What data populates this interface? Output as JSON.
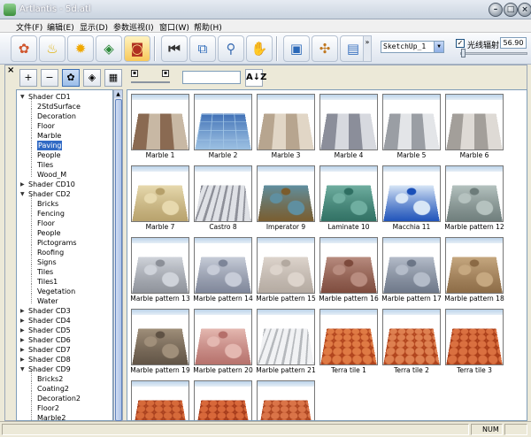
{
  "window": {
    "title": "Artlantis - 5d.atl"
  },
  "menu": [
    "文件(F)",
    "编辑(E)",
    "显示(D)",
    "参数巡视(I)",
    "窗口(W)",
    "帮助(H)"
  ],
  "toolbar": {
    "style_select": "SketchUp_1",
    "radiosity_label": "光线辐射",
    "radiosity_checked": "✓",
    "radiosity_value": "56.90",
    "more": "»"
  },
  "icons": {
    "tb": [
      "palette-icon",
      "bulb-icon",
      "sun-icon",
      "cube-icon",
      "camera-icon",
      "first-frame-icon",
      "window-icon",
      "zoom-icon",
      "hand-icon",
      "monitor-icon",
      "globe-icon",
      "book-icon"
    ],
    "sub": [
      "add-icon",
      "remove-icon",
      "shader-icon",
      "object-icon",
      "image-icon"
    ]
  },
  "sort_label": "A↓Z",
  "tree": [
    {
      "label": "Shader CD1",
      "level": 0,
      "expanded": true
    },
    {
      "label": "2StdSurface",
      "level": 1
    },
    {
      "label": "Decoration",
      "level": 1
    },
    {
      "label": "Floor",
      "level": 1
    },
    {
      "label": "Marble",
      "level": 1
    },
    {
      "label": "Paving",
      "level": 1,
      "selected": true
    },
    {
      "label": "People",
      "level": 1
    },
    {
      "label": "Tiles",
      "level": 1
    },
    {
      "label": "Wood_M",
      "level": 1
    },
    {
      "label": "Shader CD10",
      "level": 0,
      "expanded": false
    },
    {
      "label": "Shader CD2",
      "level": 0,
      "expanded": true
    },
    {
      "label": "Bricks",
      "level": 1
    },
    {
      "label": "Fencing",
      "level": 1
    },
    {
      "label": "Floor",
      "level": 1
    },
    {
      "label": "People",
      "level": 1
    },
    {
      "label": "Pictograms",
      "level": 1
    },
    {
      "label": "Roofing",
      "level": 1
    },
    {
      "label": "Signs",
      "level": 1
    },
    {
      "label": "Tiles",
      "level": 1
    },
    {
      "label": "Tiles1",
      "level": 1
    },
    {
      "label": "Vegetation",
      "level": 1
    },
    {
      "label": "Water",
      "level": 1
    },
    {
      "label": "Shader CD3",
      "level": 0,
      "expanded": false
    },
    {
      "label": "Shader CD4",
      "level": 0,
      "expanded": false
    },
    {
      "label": "Shader CD5",
      "level": 0,
      "expanded": false
    },
    {
      "label": "Shader CD6",
      "level": 0,
      "expanded": false
    },
    {
      "label": "Shader CD7",
      "level": 0,
      "expanded": false
    },
    {
      "label": "Shader CD8",
      "level": 0,
      "expanded": false
    },
    {
      "label": "Shader CD9",
      "level": 0,
      "expanded": true
    },
    {
      "label": "Bricks2",
      "level": 1
    },
    {
      "label": "Coating2",
      "level": 1
    },
    {
      "label": "Decoration2",
      "level": 1
    },
    {
      "label": "Floor2",
      "level": 1
    },
    {
      "label": "Marble2",
      "level": 1
    }
  ],
  "shaders": [
    {
      "name": "Marble 1",
      "c1": "#8a6a52",
      "c2": "#c8b8a4",
      "pattern": "checker"
    },
    {
      "name": "Marble 2",
      "c1": "#3f6fb5",
      "c2": "#9fc3e4",
      "pattern": "grid"
    },
    {
      "name": "Marble 3",
      "c1": "#b7a58f",
      "c2": "#e1d6c6",
      "pattern": "checker"
    },
    {
      "name": "Marble 4",
      "c1": "#8b8e9a",
      "c2": "#d7d9df",
      "pattern": "checker"
    },
    {
      "name": "Marble 5",
      "c1": "#9a9ea4",
      "c2": "#e3e5e8",
      "pattern": "checker"
    },
    {
      "name": "Marble 6",
      "c1": "#a39f9a",
      "c2": "#dedad5",
      "pattern": "checker"
    },
    {
      "name": "Marble 7",
      "c1": "#b6a06a",
      "c2": "#e7d9ae",
      "pattern": "stone"
    },
    {
      "name": "Castro 8",
      "c1": "#8d8f98",
      "c2": "#dfe1e6",
      "pattern": "streak"
    },
    {
      "name": "Imperator 9",
      "c1": "#7b5c2c",
      "c2": "#5f8fa0",
      "pattern": "stone"
    },
    {
      "name": "Laminate 10",
      "c1": "#2f6f62",
      "c2": "#6faea0",
      "pattern": "stone"
    },
    {
      "name": "Macchia 11",
      "c1": "#1a4fb8",
      "c2": "#d8e6f6",
      "pattern": "stone"
    },
    {
      "name": "Marble pattern 12",
      "c1": "#6d7c7a",
      "c2": "#b5c2bf",
      "pattern": "stone"
    },
    {
      "name": "Marble pattern 13",
      "c1": "#8c9098",
      "c2": "#cfd3da",
      "pattern": "stone"
    },
    {
      "name": "Marble pattern 14",
      "c1": "#7d8598",
      "c2": "#c7ccd8",
      "pattern": "stone"
    },
    {
      "name": "Marble pattern 15",
      "c1": "#b3a9a0",
      "c2": "#ddd4cc",
      "pattern": "stone"
    },
    {
      "name": "Marble pattern 16",
      "c1": "#7d4a3c",
      "c2": "#b88c7f",
      "pattern": "stone"
    },
    {
      "name": "Marble pattern 17",
      "c1": "#6c7687",
      "c2": "#b4bcc9",
      "pattern": "stone"
    },
    {
      "name": "Marble pattern 18",
      "c1": "#8b6a45",
      "c2": "#c6a880",
      "pattern": "stone"
    },
    {
      "name": "Marble pattern 19",
      "c1": "#5f5244",
      "c2": "#a08f7a",
      "pattern": "stone"
    },
    {
      "name": "Marble pattern 20",
      "c1": "#b56f6a",
      "c2": "#e4b8b1",
      "pattern": "stone"
    },
    {
      "name": "Marble pattern 21",
      "c1": "#b5b8bc",
      "c2": "#f1f2f4",
      "pattern": "streak"
    },
    {
      "name": "Terra tile 1",
      "c1": "#b0431c",
      "c2": "#df7a44",
      "pattern": "hex"
    },
    {
      "name": "Terra tile 2",
      "c1": "#b0431c",
      "c2": "#de8050",
      "pattern": "hex"
    },
    {
      "name": "Terra tile 3",
      "c1": "#a93d18",
      "c2": "#da7040",
      "pattern": "hex"
    },
    {
      "name": "",
      "c1": "#a8401e",
      "c2": "#d66a3a",
      "pattern": "hex"
    },
    {
      "name": "",
      "c1": "#a43a1a",
      "c2": "#d8683a",
      "pattern": "hex"
    },
    {
      "name": "",
      "c1": "#ab4420",
      "c2": "#da7448",
      "pattern": "hex"
    }
  ],
  "status": {
    "num": "NUM"
  },
  "colors": {
    "selection": "#316ac5",
    "border": "#7f9db9"
  }
}
